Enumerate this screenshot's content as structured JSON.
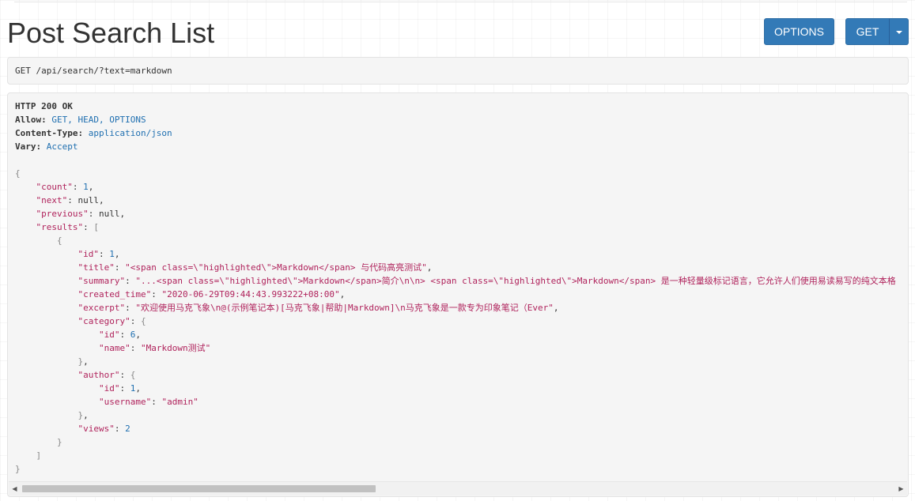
{
  "page": {
    "title": "Post Search List"
  },
  "toolbar": {
    "options_label": "OPTIONS",
    "get_label": "GET"
  },
  "request": {
    "line": "GET /api/search/?text=markdown"
  },
  "response": {
    "status": "HTTP 200 OK",
    "headers": [
      {
        "name": "Allow:",
        "value": "GET, HEAD, OPTIONS"
      },
      {
        "name": "Content-Type:",
        "value": "application/json"
      },
      {
        "name": "Vary:",
        "value": "Accept"
      }
    ],
    "body": {
      "count_key": "\"count\"",
      "count_val": "1",
      "next_key": "\"next\"",
      "next_val": "null",
      "previous_key": "\"previous\"",
      "previous_val": "null",
      "results_key": "\"results\"",
      "item": {
        "id_key": "\"id\"",
        "id_val": "1",
        "title_key": "\"title\"",
        "title_val": "\"<span class=\\\"highlighted\\\">Markdown</span> 与代码高亮测试\"",
        "summary_key": "\"summary\"",
        "summary_val": "\"...<span class=\\\"highlighted\\\">Markdown</span>简介\\n\\n> <span class=\\\"highlighted\\\">Markdown</span> 是一种轻量级标记语言，它允许人们使用易读易写的纯文本格",
        "created_time_key": "\"created_time\"",
        "created_time_val": "\"2020-06-29T09:44:43.993222+08:00\"",
        "excerpt_key": "\"excerpt\"",
        "excerpt_val": "\"欢迎使用马克飞象\\n@(示例笔记本)[马克飞象|帮助|Markdown]\\n马克飞象是一款专为印象笔记（Ever\"",
        "category_key": "\"category\"",
        "category_id_key": "\"id\"",
        "category_id_val": "6",
        "category_name_key": "\"name\"",
        "category_name_val": "\"Markdown测试\"",
        "author_key": "\"author\"",
        "author_id_key": "\"id\"",
        "author_id_val": "1",
        "author_username_key": "\"username\"",
        "author_username_val": "\"admin\"",
        "views_key": "\"views\"",
        "views_val": "2"
      }
    }
  },
  "colors": {
    "button": "#337ab7",
    "json_key": "#b0235c",
    "json_literal": "#1f6fb0"
  },
  "icons": {
    "caret": "chevron-down-icon",
    "scroll_left": "scroll-left-arrow-icon",
    "scroll_right": "scroll-right-arrow-icon"
  }
}
